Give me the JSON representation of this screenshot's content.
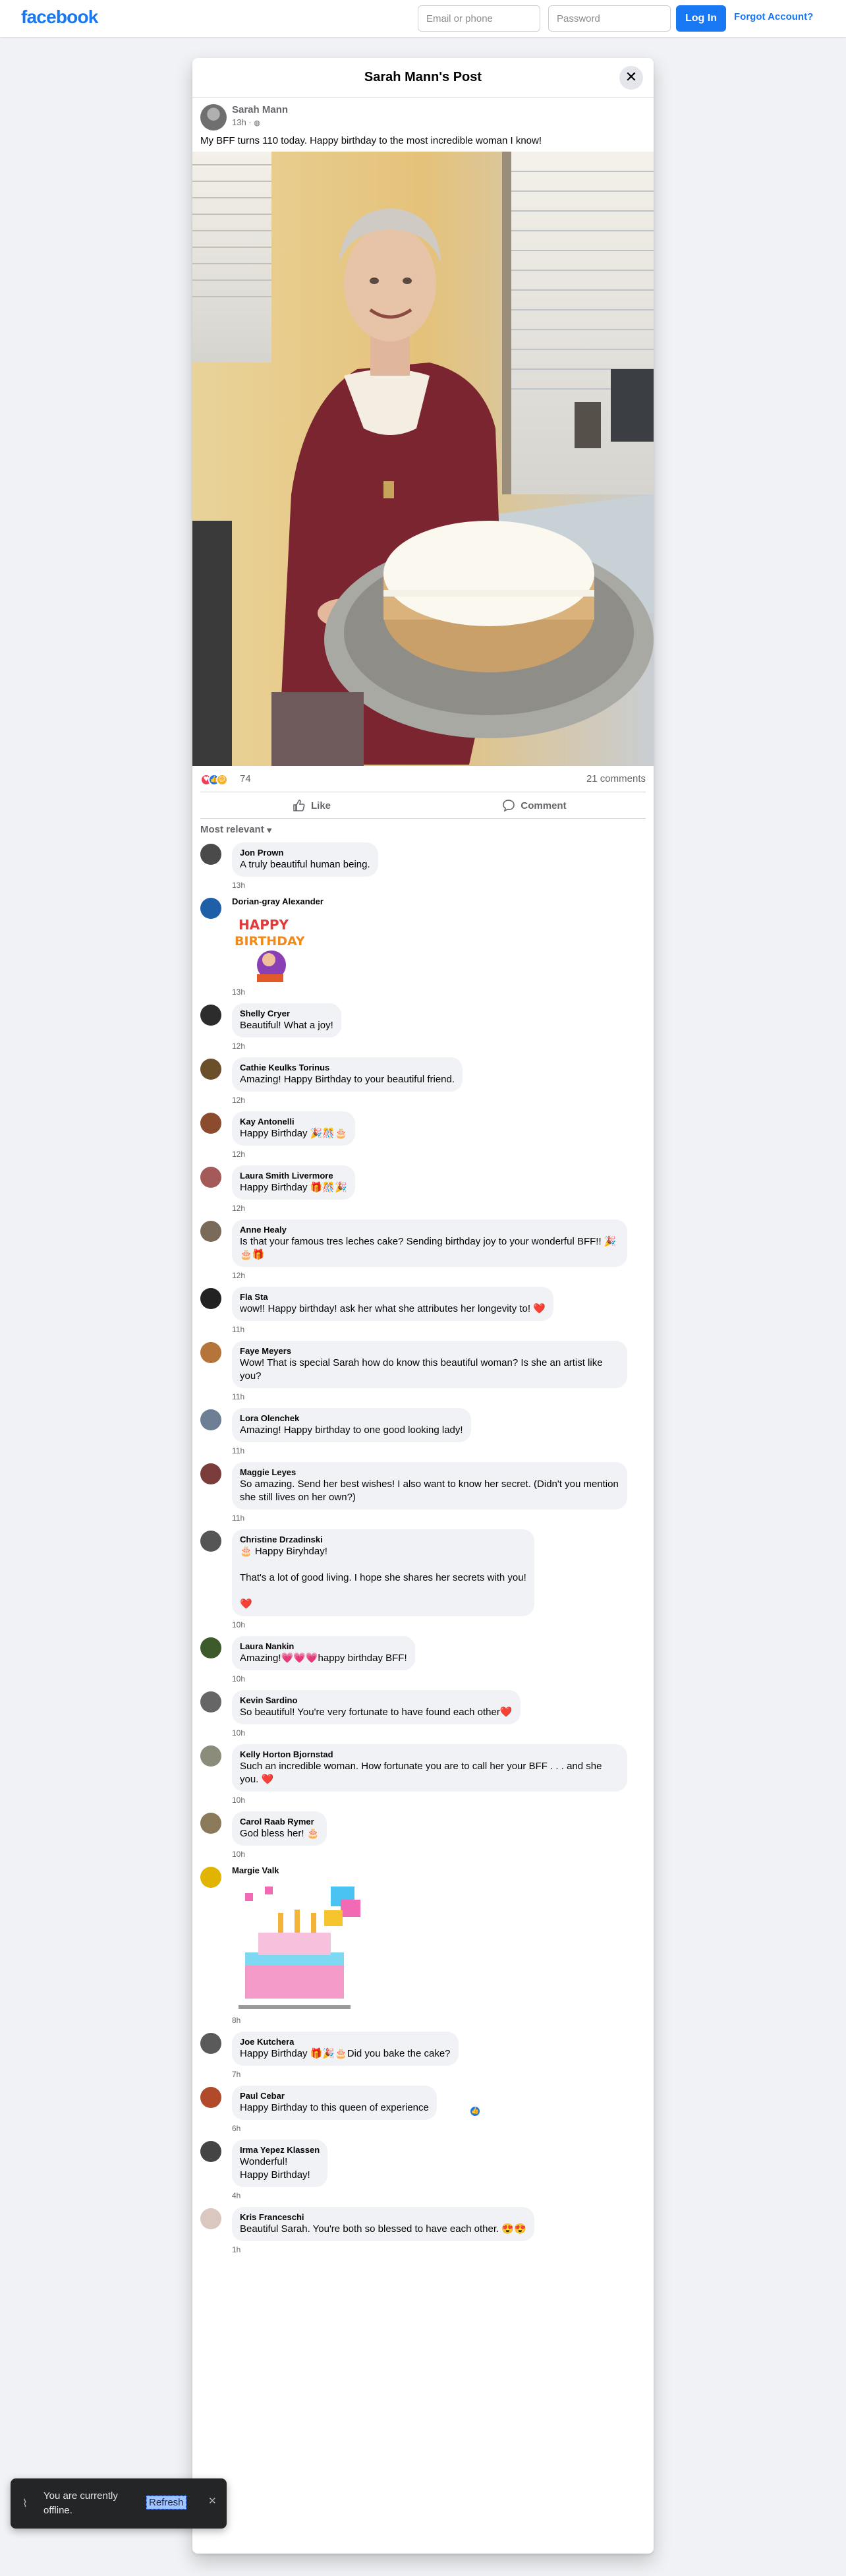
{
  "topbar": {
    "logo": "facebook",
    "email_placeholder": "Email or phone",
    "password_placeholder": "Password",
    "login_label": "Log In",
    "forgot_label": "Forgot Account?"
  },
  "modal": {
    "title": "Sarah Mann's Post",
    "close_icon": "close-icon"
  },
  "post": {
    "author": "Sarah Mann",
    "time": "13h · ",
    "privacy_icon": "globe-icon",
    "text": "My BFF turns 110 today.  Happy birthday to the most incredible woman I know!",
    "reaction_count": "74",
    "comment_count": "21 comments",
    "like_label": "Like",
    "comment_label": "Comment",
    "sort_label": "Most relevant"
  },
  "colors": {
    "accent": "#1877f2",
    "love": "#f33e58",
    "care": "#f7b125"
  },
  "comments": [
    {
      "name": "Jon Prown",
      "text": "A truly beautiful human being.",
      "time": "13h",
      "avatar": "#4a4a4a"
    },
    {
      "name": "Dorian-gray Alexander",
      "text": "",
      "time": "13h",
      "avatar": "#1f5fa8",
      "sticker": "happy-birthday-sticker"
    },
    {
      "name": "Shelly Cryer",
      "text": "Beautiful! What a joy!",
      "time": "12h",
      "avatar": "#2c2c2c"
    },
    {
      "name": "Cathie Keulks Torinus",
      "text": "Amazing! Happy Birthday to your beautiful friend.",
      "time": "12h",
      "avatar": "#6b4e2a"
    },
    {
      "name": "Kay Antonelli",
      "text": "Happy Birthday 🎉🎊🎂",
      "time": "12h",
      "avatar": "#8a4b2e"
    },
    {
      "name": "Laura Smith Livermore",
      "text": "Happy Birthday 🎁🎊🎉",
      "time": "12h",
      "avatar": "#a55a5a"
    },
    {
      "name": "Anne Healy",
      "text": "Is that your famous tres leches cake? Sending birthday joy to your wonderful BFF!! 🎉🎂🎁",
      "time": "12h",
      "avatar": "#7a6a5a"
    },
    {
      "name": "Fla Sta",
      "text": "wow!! Happy birthday! ask her what she attributes her longevity to! ❤️",
      "time": "11h",
      "avatar": "#222222"
    },
    {
      "name": "Faye Meyers",
      "text": "Wow! That is special Sarah how do know this beautiful woman? Is she an artist like you?",
      "time": "11h",
      "avatar": "#b5743a"
    },
    {
      "name": "Lora Olenchek",
      "text": "Amazing! Happy birthday to one good looking lady!",
      "time": "11h",
      "avatar": "#6d7f95"
    },
    {
      "name": "Maggie Leyes",
      "text": "So amazing. Send her best wishes! I also want to know her secret. (Didn't you mention she still lives on her own?)",
      "time": "11h",
      "avatar": "#7a3b3b"
    },
    {
      "name": "Christine Drzadinski",
      "text": "🎂 Happy Biryhday!\n\nThat's a lot of good living. I hope she shares her secrets with you!\n\n❤️",
      "time": "10h",
      "avatar": "#555555"
    },
    {
      "name": "Laura Nankin",
      "text": "Amazing!💗💗💗happy birthday BFF!",
      "time": "10h",
      "avatar": "#3c5a2a"
    },
    {
      "name": "Kevin Sardino",
      "text": "So beautiful! You're very fortunate to have found each other❤️",
      "time": "10h",
      "avatar": "#666666"
    },
    {
      "name": "Kelly Horton Bjornstad",
      "text": "Such an incredible woman. How fortunate you are to call her your BFF . . . and she you. ❤️",
      "time": "10h",
      "avatar": "#8c8c7a"
    },
    {
      "name": "Carol Raab Rymer",
      "text": "God bless her! 🎂",
      "time": "10h",
      "avatar": "#8a7a5a"
    },
    {
      "name": "Margie Valk",
      "text": "",
      "time": "8h",
      "avatar": "#e0b400",
      "sticker": "pixel-cake-sticker"
    },
    {
      "name": "Joe Kutchera",
      "text": "Happy Birthday 🎁🎉🎂Did you bake the cake?",
      "time": "7h",
      "avatar": "#5a5a5a"
    },
    {
      "name": "Paul Cebar",
      "text": "Happy Birthday to this queen of experience",
      "time": "6h",
      "avatar": "#b04a2a",
      "like_badge": true
    },
    {
      "name": "Irma Yepez Klassen",
      "text": "Wonderful!\nHappy Birthday!",
      "time": "4h",
      "avatar": "#444444"
    },
    {
      "name": "Kris Franceschi",
      "text": "Beautiful Sarah. You're both so blessed to have each other. 😍😍",
      "time": "1h",
      "avatar": "#d9c7c0"
    }
  ],
  "toast": {
    "text": "You are currently offline.",
    "refresh_label": "Refresh",
    "icon": "wifi-off-icon",
    "close_icon": "close-icon"
  }
}
